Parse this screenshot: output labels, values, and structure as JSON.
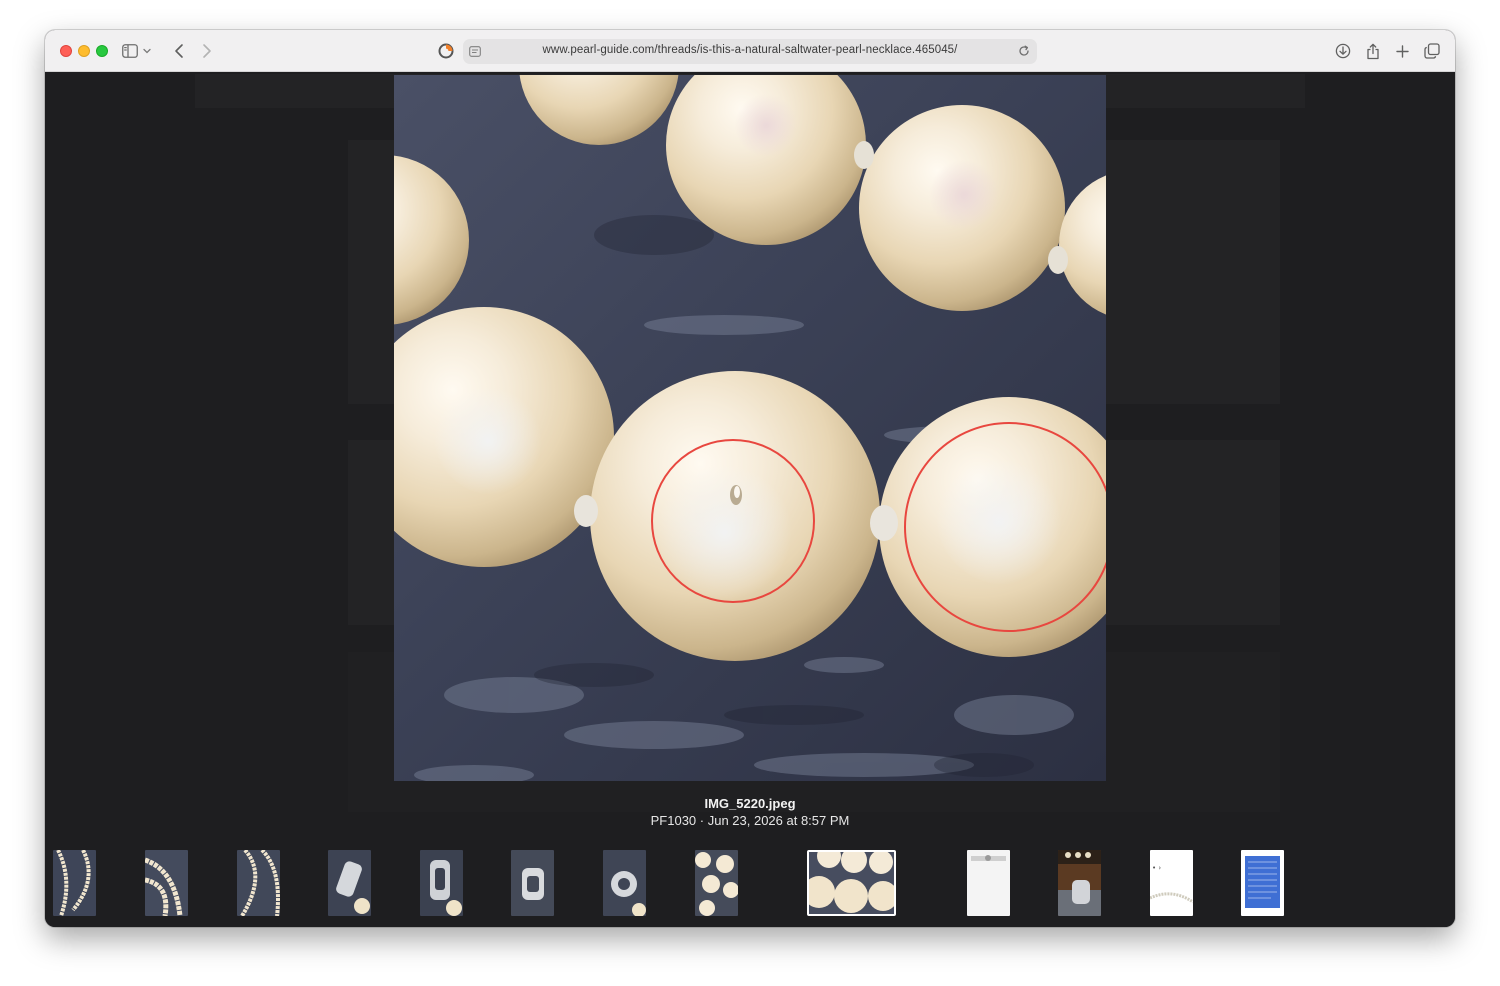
{
  "browser": {
    "url": "www.pearl-guide.com/threads/is-this-a-natural-saltwater-pearl-necklace.465045/"
  },
  "viewer": {
    "filename": "IMG_5220.jpeg",
    "meta": "PF1030 · Jun 23, 2026 at 8:57 PM"
  },
  "thumbnails": [
    {
      "name": "thumb-necklace-1",
      "kind": "pearls-on-stone"
    },
    {
      "name": "thumb-necklace-2",
      "kind": "pearls-on-stone"
    },
    {
      "name": "thumb-necklace-3",
      "kind": "pearls-on-stone"
    },
    {
      "name": "thumb-clasp-1",
      "kind": "clasp"
    },
    {
      "name": "thumb-clasp-2",
      "kind": "clasp"
    },
    {
      "name": "thumb-clasp-3",
      "kind": "clasp"
    },
    {
      "name": "thumb-clasp-4",
      "kind": "clasp"
    },
    {
      "name": "thumb-pearls-closeup",
      "kind": "pearls-closeup"
    },
    {
      "name": "thumb-current",
      "kind": "current",
      "selected": true
    },
    {
      "name": "thumb-white-doc",
      "kind": "white-doc"
    },
    {
      "name": "thumb-brown-photo",
      "kind": "brown-photo"
    },
    {
      "name": "thumb-strand-white",
      "kind": "strand-white"
    },
    {
      "name": "thumb-blue-doc",
      "kind": "blue-doc"
    }
  ],
  "colors": {
    "accent_close": "#fe5f57",
    "accent_minimize": "#febc2e",
    "accent_zoom": "#28c840",
    "viewer_bg": "#1e1e20",
    "annotation_circle": "#e8473f"
  },
  "icons": [
    "sidebar-icon",
    "chevron-down-icon",
    "back-icon",
    "forward-icon",
    "site-icon",
    "reader-icon",
    "reload-icon",
    "downloads-icon",
    "share-icon",
    "new-tab-icon",
    "tabs-overview-icon"
  ]
}
